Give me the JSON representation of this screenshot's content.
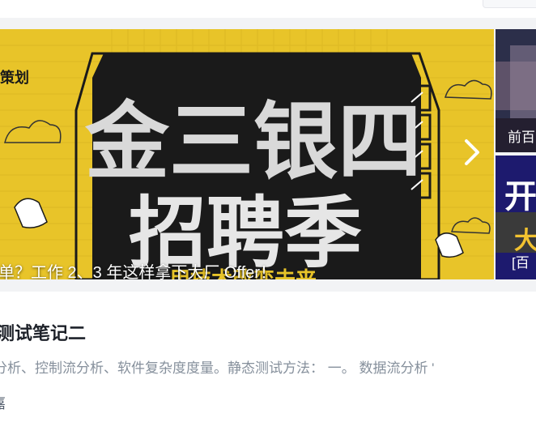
{
  "header": {
    "search_box": ""
  },
  "banner": {
    "tag": "策划",
    "headline_line1": "金三银四",
    "headline_line2": "招聘季",
    "headline_line3": "用技术改变未来",
    "caption": "单？工作 2、3 年这样拿下大厂 Offer！",
    "next_icon": "chevron-right-icon",
    "bg_color": "#e8c429"
  },
  "side_cards": [
    {
      "caption": "前百"
    },
    {
      "big_text": "开",
      "big_text2": "大",
      "caption": "[百"
    }
  ],
  "article": {
    "title": "测试笔记二",
    "summary": "分析、控制流分析、软件复杂度度量。静态测试方法：  一。 数据流分析 '",
    "meta": "嘉"
  }
}
